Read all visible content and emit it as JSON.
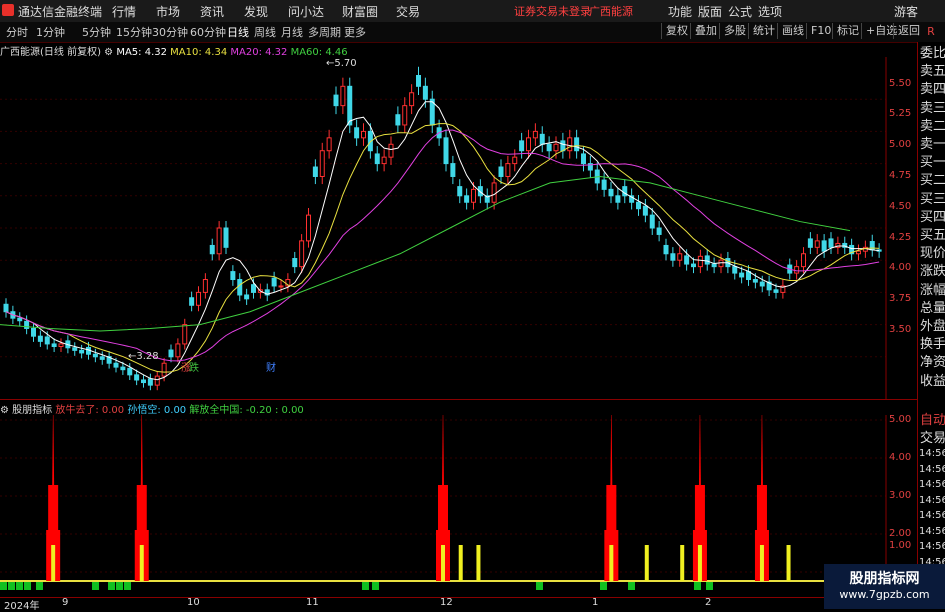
{
  "app": {
    "title": "通达信金融终端",
    "menus": [
      "行情",
      "市场",
      "资讯",
      "发现",
      "问小达",
      "财富圈",
      "交易"
    ],
    "notice": "证券交易未登录",
    "stock_name": "广西能源",
    "right_menus": [
      "功能",
      "版面",
      "公式",
      "选项"
    ],
    "user": "游客",
    "r_icon": "R"
  },
  "toolbar": {
    "periods": [
      "分时",
      "1分钟",
      "5分钟",
      "15分钟",
      "30分钟",
      "60分钟",
      "日线",
      "周线",
      "月线",
      "多周期",
      "更多"
    ],
    "active": "日线",
    "buttons": [
      "复权",
      "叠加",
      "多股",
      "统计",
      "画线",
      "F10",
      "标记",
      "+自选",
      "返回"
    ]
  },
  "main": {
    "title": "广西能源(日线 前复权)",
    "ma": [
      {
        "label": "MA5: 4.32",
        "color": "#ffffff"
      },
      {
        "label": "MA10: 4.34",
        "color": "#e8e040"
      },
      {
        "label": "MA20: 4.32",
        "color": "#e040e0"
      },
      {
        "label": "MA60: 4.46",
        "color": "#40d040"
      }
    ],
    "high_label": "5.70",
    "low_label": "3.28",
    "price_ticks": [
      "5.50",
      "5.25",
      "5.00",
      "4.75",
      "4.50",
      "4.25",
      "4.00",
      "3.75",
      "3.50"
    ],
    "badges": [
      {
        "text": "涨",
        "color": "#e04040"
      },
      {
        "text": "跌",
        "color": "#40c040"
      },
      {
        "text": "财",
        "color": "#4080ff"
      }
    ]
  },
  "sub": {
    "title": "股朋指标",
    "items": [
      {
        "label": "放牛去了: 0.00",
        "color": "#e04040"
      },
      {
        "label": "孙悟空: 0.00",
        "color": "#40d0ff"
      },
      {
        "label": "解放全中国: -0.20 : 0.00",
        "color": "#40d040"
      }
    ],
    "ticks": [
      "5.00",
      "4.00",
      "3.00",
      "2.00",
      "1.00"
    ]
  },
  "x_axis": [
    "2024年",
    "9",
    "10",
    "11",
    "12",
    "1",
    "2"
  ],
  "right_panel": [
    "委比",
    "卖五",
    "卖四",
    "卖三",
    "卖二",
    "卖一",
    "买一",
    "买二",
    "买三",
    "买四",
    "买五",
    "现价",
    "涨跌",
    "涨幅",
    "总量",
    "外盘",
    "换手",
    "净资",
    "收益"
  ],
  "right_panel2": [
    "自动",
    "交易"
  ],
  "times": [
    "14:56",
    "14:56",
    "14:56",
    "14:56",
    "14:56",
    "14:56",
    "14:56",
    "14:56",
    "14:56",
    "14:56"
  ],
  "watermark": {
    "line1": "股朋指标网",
    "line2": "www.7gpzb.com"
  },
  "chart_data": {
    "type": "candlestick",
    "closes": [
      3.85,
      3.8,
      3.78,
      3.72,
      3.66,
      3.62,
      3.6,
      3.58,
      3.6,
      3.57,
      3.55,
      3.53,
      3.52,
      3.5,
      3.48,
      3.45,
      3.42,
      3.4,
      3.36,
      3.32,
      3.3,
      3.28,
      3.35,
      3.45,
      3.5,
      3.6,
      3.75,
      3.9,
      4.0,
      4.1,
      4.3,
      4.5,
      4.35,
      4.1,
      3.98,
      3.95,
      4.0,
      4.02,
      3.98,
      4.05,
      4.05,
      4.1,
      4.2,
      4.4,
      4.6,
      4.9,
      5.1,
      5.2,
      5.45,
      5.6,
      5.3,
      5.2,
      5.25,
      5.1,
      5.0,
      5.05,
      5.15,
      5.3,
      5.45,
      5.55,
      5.6,
      5.5,
      5.3,
      5.2,
      5.0,
      4.9,
      4.75,
      4.7,
      4.8,
      4.75,
      4.7,
      4.85,
      4.9,
      5.0,
      5.05,
      5.1,
      5.2,
      5.25,
      5.15,
      5.1,
      5.15,
      5.1,
      5.2,
      5.1,
      5.0,
      4.95,
      4.85,
      4.8,
      4.75,
      4.7,
      4.75,
      4.7,
      4.65,
      4.6,
      4.5,
      4.45,
      4.3,
      4.25,
      4.3,
      4.22,
      4.2,
      4.28,
      4.22,
      4.2,
      4.25,
      4.2,
      4.15,
      4.12,
      4.1,
      4.08,
      4.05,
      4.02,
      4.0,
      4.05,
      4.15,
      4.2,
      4.3,
      4.35,
      4.4,
      4.32,
      4.35,
      4.38,
      4.35,
      4.3,
      4.32,
      4.35,
      4.33,
      4.32
    ],
    "ylim": [
      3.25,
      5.75
    ],
    "ma60": [
      3.75,
      3.72,
      3.7,
      3.72,
      3.75,
      3.85,
      4.0,
      4.15,
      4.3,
      4.5,
      4.7,
      4.85,
      4.9,
      4.85,
      4.75,
      4.65,
      4.55,
      4.48
    ]
  },
  "indicator": {
    "red_peaks": [
      0.06,
      0.16,
      0.5,
      0.69,
      0.79,
      0.86
    ],
    "yellow": [
      0.06,
      0.16,
      0.5,
      0.52,
      0.54,
      0.69,
      0.73,
      0.77,
      0.79,
      0.86,
      0.89
    ]
  }
}
